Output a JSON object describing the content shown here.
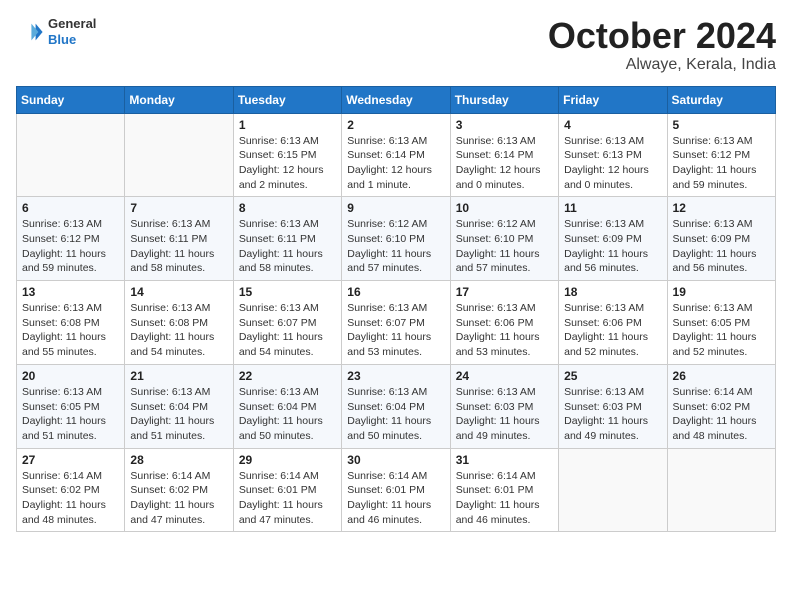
{
  "header": {
    "logo": {
      "general": "General",
      "blue": "Blue"
    },
    "title": "October 2024",
    "location": "Alwaye, Kerala, India"
  },
  "calendar": {
    "days_of_week": [
      "Sunday",
      "Monday",
      "Tuesday",
      "Wednesday",
      "Thursday",
      "Friday",
      "Saturday"
    ],
    "weeks": [
      [
        {
          "day": "",
          "content": ""
        },
        {
          "day": "",
          "content": ""
        },
        {
          "day": "1",
          "content": "Sunrise: 6:13 AM\nSunset: 6:15 PM\nDaylight: 12 hours\nand 2 minutes."
        },
        {
          "day": "2",
          "content": "Sunrise: 6:13 AM\nSunset: 6:14 PM\nDaylight: 12 hours\nand 1 minute."
        },
        {
          "day": "3",
          "content": "Sunrise: 6:13 AM\nSunset: 6:14 PM\nDaylight: 12 hours\nand 0 minutes."
        },
        {
          "day": "4",
          "content": "Sunrise: 6:13 AM\nSunset: 6:13 PM\nDaylight: 12 hours\nand 0 minutes."
        },
        {
          "day": "5",
          "content": "Sunrise: 6:13 AM\nSunset: 6:12 PM\nDaylight: 11 hours\nand 59 minutes."
        }
      ],
      [
        {
          "day": "6",
          "content": "Sunrise: 6:13 AM\nSunset: 6:12 PM\nDaylight: 11 hours\nand 59 minutes."
        },
        {
          "day": "7",
          "content": "Sunrise: 6:13 AM\nSunset: 6:11 PM\nDaylight: 11 hours\nand 58 minutes."
        },
        {
          "day": "8",
          "content": "Sunrise: 6:13 AM\nSunset: 6:11 PM\nDaylight: 11 hours\nand 58 minutes."
        },
        {
          "day": "9",
          "content": "Sunrise: 6:12 AM\nSunset: 6:10 PM\nDaylight: 11 hours\nand 57 minutes."
        },
        {
          "day": "10",
          "content": "Sunrise: 6:12 AM\nSunset: 6:10 PM\nDaylight: 11 hours\nand 57 minutes."
        },
        {
          "day": "11",
          "content": "Sunrise: 6:13 AM\nSunset: 6:09 PM\nDaylight: 11 hours\nand 56 minutes."
        },
        {
          "day": "12",
          "content": "Sunrise: 6:13 AM\nSunset: 6:09 PM\nDaylight: 11 hours\nand 56 minutes."
        }
      ],
      [
        {
          "day": "13",
          "content": "Sunrise: 6:13 AM\nSunset: 6:08 PM\nDaylight: 11 hours\nand 55 minutes."
        },
        {
          "day": "14",
          "content": "Sunrise: 6:13 AM\nSunset: 6:08 PM\nDaylight: 11 hours\nand 54 minutes."
        },
        {
          "day": "15",
          "content": "Sunrise: 6:13 AM\nSunset: 6:07 PM\nDaylight: 11 hours\nand 54 minutes."
        },
        {
          "day": "16",
          "content": "Sunrise: 6:13 AM\nSunset: 6:07 PM\nDaylight: 11 hours\nand 53 minutes."
        },
        {
          "day": "17",
          "content": "Sunrise: 6:13 AM\nSunset: 6:06 PM\nDaylight: 11 hours\nand 53 minutes."
        },
        {
          "day": "18",
          "content": "Sunrise: 6:13 AM\nSunset: 6:06 PM\nDaylight: 11 hours\nand 52 minutes."
        },
        {
          "day": "19",
          "content": "Sunrise: 6:13 AM\nSunset: 6:05 PM\nDaylight: 11 hours\nand 52 minutes."
        }
      ],
      [
        {
          "day": "20",
          "content": "Sunrise: 6:13 AM\nSunset: 6:05 PM\nDaylight: 11 hours\nand 51 minutes."
        },
        {
          "day": "21",
          "content": "Sunrise: 6:13 AM\nSunset: 6:04 PM\nDaylight: 11 hours\nand 51 minutes."
        },
        {
          "day": "22",
          "content": "Sunrise: 6:13 AM\nSunset: 6:04 PM\nDaylight: 11 hours\nand 50 minutes."
        },
        {
          "day": "23",
          "content": "Sunrise: 6:13 AM\nSunset: 6:04 PM\nDaylight: 11 hours\nand 50 minutes."
        },
        {
          "day": "24",
          "content": "Sunrise: 6:13 AM\nSunset: 6:03 PM\nDaylight: 11 hours\nand 49 minutes."
        },
        {
          "day": "25",
          "content": "Sunrise: 6:13 AM\nSunset: 6:03 PM\nDaylight: 11 hours\nand 49 minutes."
        },
        {
          "day": "26",
          "content": "Sunrise: 6:14 AM\nSunset: 6:02 PM\nDaylight: 11 hours\nand 48 minutes."
        }
      ],
      [
        {
          "day": "27",
          "content": "Sunrise: 6:14 AM\nSunset: 6:02 PM\nDaylight: 11 hours\nand 48 minutes."
        },
        {
          "day": "28",
          "content": "Sunrise: 6:14 AM\nSunset: 6:02 PM\nDaylight: 11 hours\nand 47 minutes."
        },
        {
          "day": "29",
          "content": "Sunrise: 6:14 AM\nSunset: 6:01 PM\nDaylight: 11 hours\nand 47 minutes."
        },
        {
          "day": "30",
          "content": "Sunrise: 6:14 AM\nSunset: 6:01 PM\nDaylight: 11 hours\nand 46 minutes."
        },
        {
          "day": "31",
          "content": "Sunrise: 6:14 AM\nSunset: 6:01 PM\nDaylight: 11 hours\nand 46 minutes."
        },
        {
          "day": "",
          "content": ""
        },
        {
          "day": "",
          "content": ""
        }
      ]
    ]
  }
}
